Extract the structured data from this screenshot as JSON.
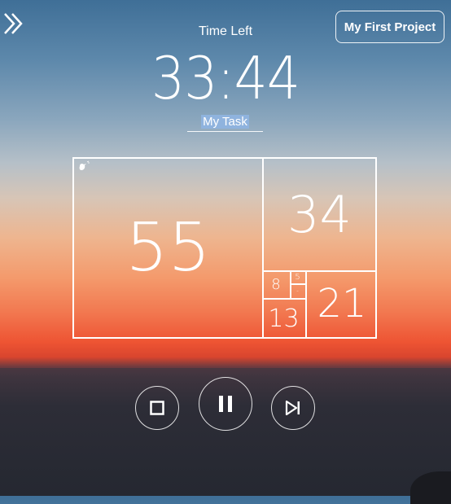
{
  "header": {
    "project_button": "My First Project",
    "time_left_label": "Time Left",
    "timer_value": "33:44",
    "task_name": "My Task"
  },
  "fibonacci": {
    "v55": "55",
    "v34": "34",
    "v21": "21",
    "v13": "13",
    "v8": "8",
    "v5": "5",
    "v3": "-"
  },
  "controls": {
    "stop_icon": "stop-icon",
    "pause_icon": "pause-icon",
    "skip_icon": "skip-icon"
  },
  "colors": {
    "sky_top": "#3f6f97",
    "sunset": "#ee5433",
    "task_highlight": "#8fb3de"
  }
}
